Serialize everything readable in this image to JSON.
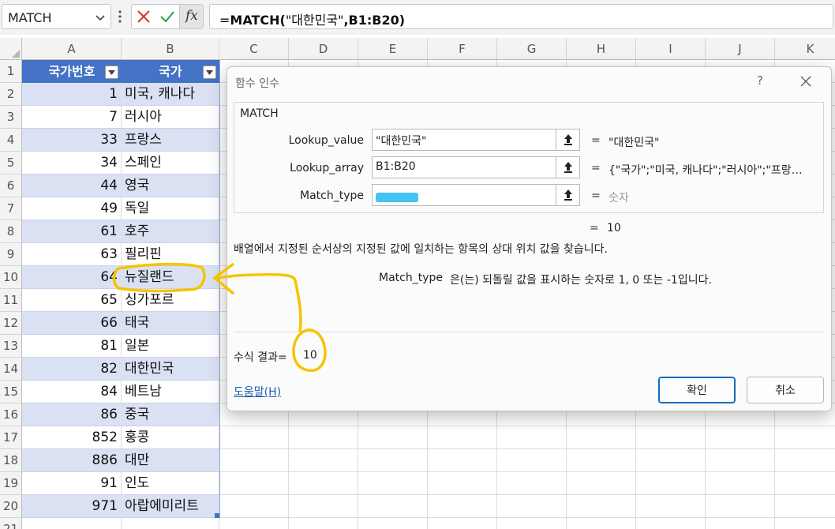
{
  "formula_bar": {
    "name_box": "MATCH",
    "formula_prefix": "=",
    "formula_func": "MATCH(",
    "formula_arg1": "\"대한민국\"",
    "formula_rest": ",B1:B20)"
  },
  "columns": [
    "A",
    "B",
    "C",
    "D",
    "E",
    "F",
    "G",
    "H",
    "I",
    "J",
    "K"
  ],
  "rows": [
    "1",
    "2",
    "3",
    "4",
    "5",
    "6",
    "7",
    "8",
    "9",
    "10",
    "11",
    "12",
    "13",
    "14",
    "15",
    "16",
    "17",
    "18",
    "19",
    "20",
    "21"
  ],
  "table": {
    "header_a": "국가번호",
    "header_b": "국가",
    "data": [
      {
        "code": "1",
        "country": "미국, 캐나다"
      },
      {
        "code": "7",
        "country": "러시아"
      },
      {
        "code": "33",
        "country": "프랑스"
      },
      {
        "code": "34",
        "country": "스페인"
      },
      {
        "code": "44",
        "country": "영국"
      },
      {
        "code": "49",
        "country": "독일"
      },
      {
        "code": "61",
        "country": "호주"
      },
      {
        "code": "63",
        "country": "필리핀"
      },
      {
        "code": "64",
        "country": "뉴질랜드"
      },
      {
        "code": "65",
        "country": "싱가포르"
      },
      {
        "code": "66",
        "country": "태국"
      },
      {
        "code": "81",
        "country": "일본"
      },
      {
        "code": "82",
        "country": "대한민국"
      },
      {
        "code": "84",
        "country": "베트남"
      },
      {
        "code": "86",
        "country": "중국"
      },
      {
        "code": "852",
        "country": "홍콩"
      },
      {
        "code": "886",
        "country": "대만"
      },
      {
        "code": "91",
        "country": "인도"
      },
      {
        "code": "971",
        "country": "아랍에미리트"
      }
    ]
  },
  "dialog": {
    "title": "함수 인수",
    "help_glyph": "?",
    "function_name": "MATCH",
    "args": [
      {
        "label": "Lookup_value",
        "input": "\"대한민국\"",
        "result": "\"대한민국\""
      },
      {
        "label": "Lookup_array",
        "input": "B1:B20",
        "result": "{\"국가\";\"미국, 캐나다\";\"러시아\";\"프랑…"
      },
      {
        "label": "Match_type",
        "input": "",
        "result": "숫자"
      }
    ],
    "eq": "=",
    "formula_result": "10",
    "description": "배열에서 지정된 순서상의 지정된 값에 일치하는 항목의 상대 위치 값을 찾습니다.",
    "arg_help_name": "Match_type",
    "arg_help_text": "은(는) 되돌릴 값을 표시하는 숫자로 1, 0 또는 -1입니다.",
    "result_label": "수식 결과=",
    "result_value": "10",
    "help_link": "도움말(H)",
    "ok_label": "확인",
    "cancel_label": "취소"
  },
  "colors": {
    "table_header": "#4472c4",
    "band": "#d9e1f2",
    "annotation": "#f5c400",
    "redaction": "#45c3f2"
  }
}
